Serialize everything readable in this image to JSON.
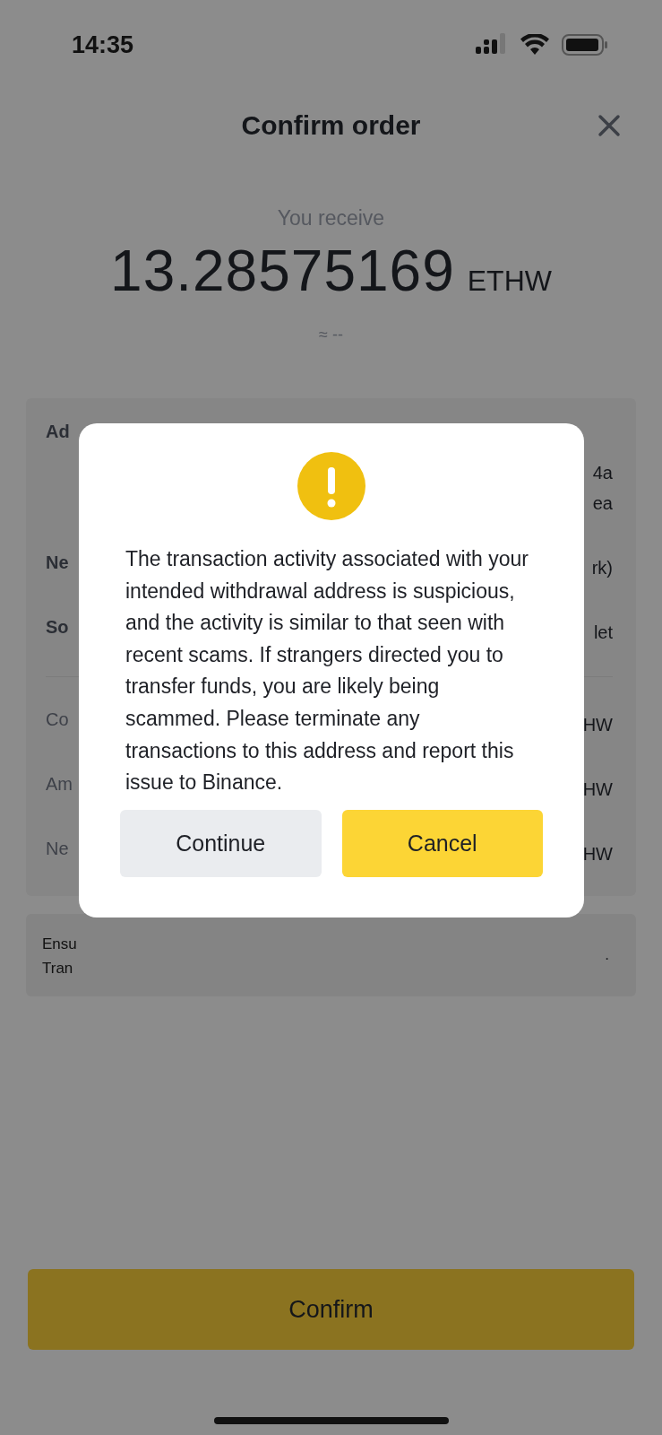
{
  "status_bar": {
    "time": "14:35"
  },
  "header": {
    "title": "Confirm order"
  },
  "summary": {
    "label": "You receive",
    "amount": "13.28575169",
    "unit": "ETHW",
    "fiat": "≈ --"
  },
  "details_top": [
    {
      "label": "Ad",
      "value_lines": [
        "4a",
        "ea"
      ]
    },
    {
      "label": "Ne",
      "value_lines": [
        "rk)"
      ]
    },
    {
      "label": "So",
      "value_lines": [
        "let"
      ]
    }
  ],
  "details_bottom": [
    {
      "label": "Co",
      "value_lines": [
        "HW"
      ]
    },
    {
      "label": "Am",
      "value_lines": [
        "HW"
      ]
    },
    {
      "label": "Ne",
      "value_lines": [
        "HW"
      ]
    }
  ],
  "notice": {
    "lines": [
      "Ensu",
      "Tran"
    ],
    "end": "."
  },
  "confirm_button": "Confirm",
  "dialog": {
    "message": "The transaction activity associated with your intended withdrawal address is suspicious, and the activity is similar to that seen with recent scams. If strangers directed you to transfer funds, you are likely being scammed. Please terminate any transactions to this address and report this issue to Binance.",
    "buttons": [
      {
        "label": "Continue",
        "kind": "secondary"
      },
      {
        "label": "Cancel",
        "kind": "primary"
      }
    ]
  }
}
